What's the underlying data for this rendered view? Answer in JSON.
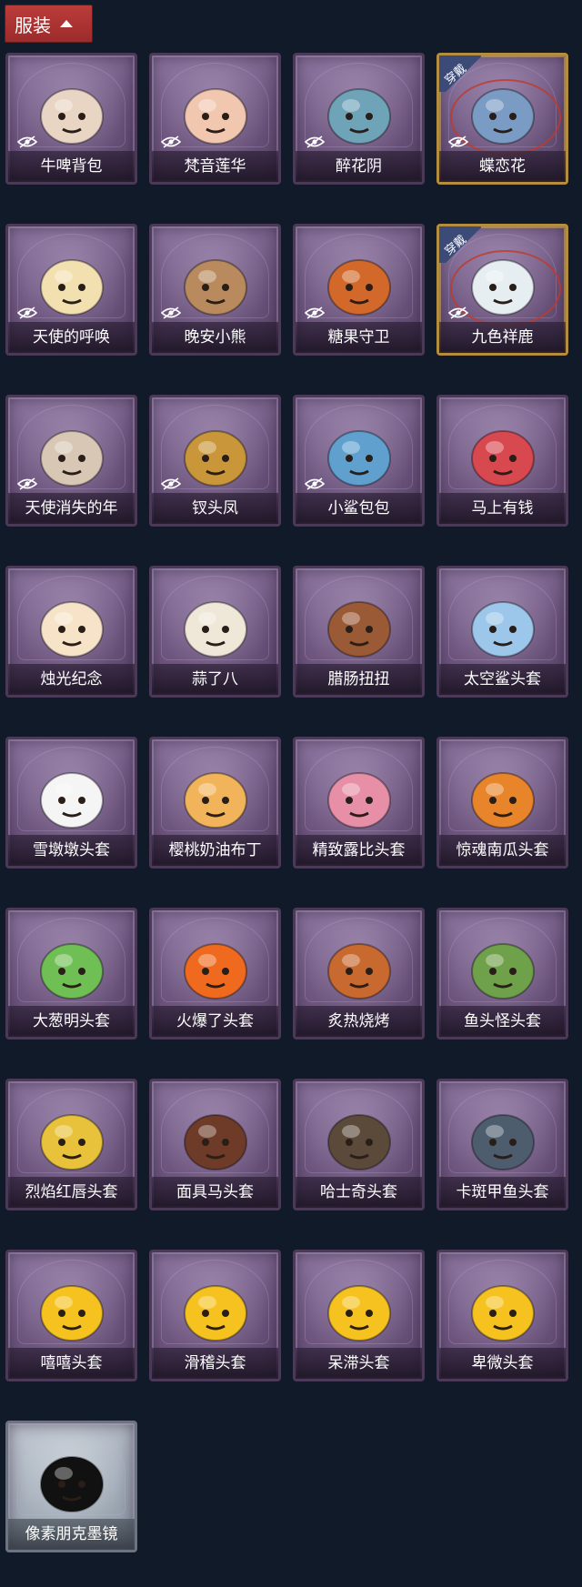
{
  "header": {
    "label": "服装"
  },
  "items": [
    {
      "name": "牛啤背包",
      "equipped": false,
      "hidden": true,
      "style": "purple",
      "icon": "cow-beer-backpack-icon",
      "color": "#e8d5c4"
    },
    {
      "name": "梵音莲华",
      "equipped": false,
      "hidden": true,
      "style": "purple",
      "icon": "lotus-girl-icon",
      "color": "#f2c7b0"
    },
    {
      "name": "醉花阴",
      "equipped": false,
      "hidden": true,
      "style": "purple",
      "icon": "hanging-ornament-icon",
      "color": "#6fa3b8"
    },
    {
      "name": "蝶恋花",
      "equipped": true,
      "hidden": true,
      "style": "purple",
      "icon": "bell-wreath-icon",
      "color": "#7a9cc4",
      "equip_label": "穿戴"
    },
    {
      "name": "天使的呼唤",
      "equipped": false,
      "hidden": true,
      "style": "purple",
      "icon": "angel-doll-icon",
      "color": "#f3e0b0"
    },
    {
      "name": "晚安小熊",
      "equipped": false,
      "hidden": true,
      "style": "purple",
      "icon": "bear-charm-icon",
      "color": "#b98a5e"
    },
    {
      "name": "糖果守卫",
      "equipped": false,
      "hidden": true,
      "style": "purple",
      "icon": "pumpkin-scarecrow-icon",
      "color": "#d2692a"
    },
    {
      "name": "九色祥鹿",
      "equipped": true,
      "hidden": true,
      "style": "purple",
      "icon": "deer-charm-icon",
      "color": "#e6eef2",
      "equip_label": "穿戴"
    },
    {
      "name": "天使消失的年",
      "equipped": false,
      "hidden": true,
      "style": "purple",
      "icon": "veiled-angel-icon",
      "color": "#d8c7b4"
    },
    {
      "name": "钗头凤",
      "equipped": false,
      "hidden": true,
      "style": "purple",
      "icon": "phoenix-crown-icon",
      "color": "#c9963a"
    },
    {
      "name": "小鲨包包",
      "equipped": false,
      "hidden": true,
      "style": "purple",
      "icon": "shark-bag-icon",
      "color": "#5fa0cf"
    },
    {
      "name": "马上有钱",
      "equipped": false,
      "hidden": false,
      "style": "purple",
      "icon": "red-horse-head-icon",
      "color": "#d8484f"
    },
    {
      "name": "烛光纪念",
      "equipped": false,
      "hidden": false,
      "style": "purple",
      "icon": "candle-head-icon",
      "color": "#f6e3c8"
    },
    {
      "name": "蒜了八",
      "equipped": false,
      "hidden": false,
      "style": "purple",
      "icon": "garlic-head-icon",
      "color": "#efe8d8"
    },
    {
      "name": "腊肠扭扭",
      "equipped": false,
      "hidden": false,
      "style": "purple",
      "icon": "dog-head-icon",
      "color": "#9a5a35"
    },
    {
      "name": "太空鲨头套",
      "equipped": false,
      "hidden": false,
      "style": "purple",
      "icon": "space-shark-icon",
      "color": "#9cc7ea"
    },
    {
      "name": "雪墩墩头套",
      "equipped": false,
      "hidden": false,
      "style": "purple",
      "icon": "snowman-head-icon",
      "color": "#f5f5f5"
    },
    {
      "name": "樱桃奶油布丁",
      "equipped": false,
      "hidden": false,
      "style": "purple",
      "icon": "pudding-head-icon",
      "color": "#f2b45a"
    },
    {
      "name": "精致露比头套",
      "equipped": false,
      "hidden": false,
      "style": "purple",
      "icon": "pink-beaver-icon",
      "color": "#e68fa7"
    },
    {
      "name": "惊魂南瓜头套",
      "equipped": false,
      "hidden": false,
      "style": "purple",
      "icon": "pumpkin-head-icon",
      "color": "#e8852a"
    },
    {
      "name": "大葱明头套",
      "equipped": false,
      "hidden": false,
      "style": "purple",
      "icon": "scallion-head-icon",
      "color": "#6fbf55"
    },
    {
      "name": "火爆了头套",
      "equipped": false,
      "hidden": false,
      "style": "purple",
      "icon": "fire-head-icon",
      "color": "#ef6a1e"
    },
    {
      "name": "炙热烧烤",
      "equipped": false,
      "hidden": false,
      "style": "purple",
      "icon": "bbq-meat-icon",
      "color": "#c8692f"
    },
    {
      "name": "鱼头怪头套",
      "equipped": false,
      "hidden": false,
      "style": "purple",
      "icon": "fish-head-icon",
      "color": "#6fa04a"
    },
    {
      "name": "烈焰红唇头套",
      "equipped": false,
      "hidden": false,
      "style": "purple",
      "icon": "yellow-mask-icon",
      "color": "#e8c23a"
    },
    {
      "name": "面具马头套",
      "equipped": false,
      "hidden": false,
      "style": "purple",
      "icon": "horse-mask-icon",
      "color": "#6e3b28"
    },
    {
      "name": "哈士奇头套",
      "equipped": false,
      "hidden": false,
      "style": "purple",
      "icon": "husky-head-icon",
      "color": "#5b4a3a"
    },
    {
      "name": "卡斑甲鱼头套",
      "equipped": false,
      "hidden": false,
      "style": "purple",
      "icon": "fish-blob-icon",
      "color": "#4e5d6e"
    },
    {
      "name": "嘻嘻头套",
      "equipped": false,
      "hidden": false,
      "style": "purple",
      "icon": "grin-emoji-icon",
      "color": "#f5c21f"
    },
    {
      "name": "滑稽头套",
      "equipped": false,
      "hidden": false,
      "style": "purple",
      "icon": "smirk-emoji-icon",
      "color": "#f5c21f"
    },
    {
      "name": "呆滞头套",
      "equipped": false,
      "hidden": false,
      "style": "purple",
      "icon": "stare-emoji-icon",
      "color": "#f5c21f"
    },
    {
      "name": "卑微头套",
      "equipped": false,
      "hidden": false,
      "style": "purple",
      "icon": "humble-emoji-icon",
      "color": "#f5c21f"
    },
    {
      "name": "像素朋克墨镜",
      "equipped": false,
      "hidden": false,
      "style": "gray",
      "icon": "pixel-sunglasses-icon",
      "color": "#111111"
    }
  ]
}
